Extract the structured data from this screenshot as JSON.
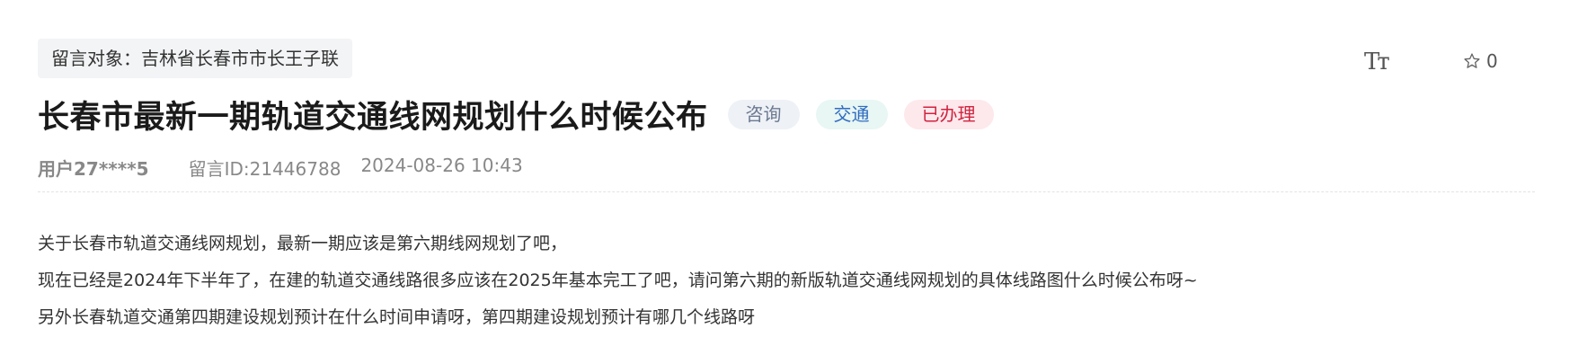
{
  "recipient": "留言对象：吉林省长春市市长王子联",
  "tools": {
    "font_size_label": "Tт",
    "favorite_count": "0"
  },
  "title": "长春市最新一期轨道交通线网规划什么时候公布",
  "tags": [
    "咨询",
    "交通",
    "已办理"
  ],
  "meta": {
    "user": "用户27****5",
    "message_id": "留言ID:21446788",
    "time": "2024-08-26 10:43"
  },
  "content": [
    "关于长春市轨道交通线网规划，最新一期应该是第六期线网规划了吧，",
    "现在已经是2024年下半年了，在建的轨道交通线路很多应该在2025年基本完工了吧，请问第六期的新版轨道交通线网规划的具体线路图什么时候公布呀~",
    "另外长春轨道交通第四期建设规划预计在什么时间申请呀，第四期建设规划预计有哪几个线路呀"
  ],
  "colors": {
    "tag_consult": "#6c7a91",
    "tag_traffic": "#2f6cc0",
    "tag_done": "#d0243f"
  }
}
